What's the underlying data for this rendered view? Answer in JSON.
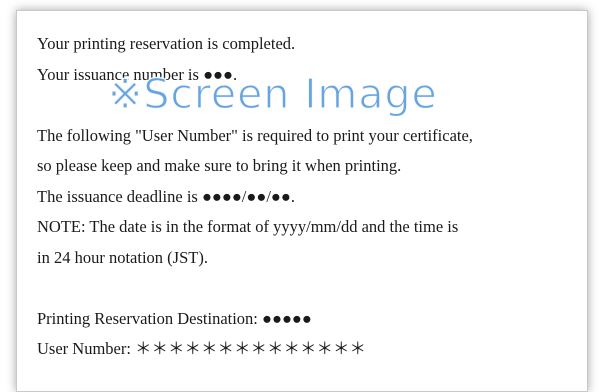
{
  "card": {
    "line1": "Your printing reservation is completed.",
    "line2": "Your issuance number is ●●●.",
    "line3": "The following \"User Number\" is required to print your certificate,",
    "line4": "so please keep and make sure to bring it when printing.",
    "line5": "The issuance deadline is ●●●●/●●/●●.",
    "line6": "NOTE: The date is in the format of yyyy/mm/dd and the time is",
    "line7": "in 24 hour notation (JST).",
    "line8": "Printing Reservation Destination: ●●●●●",
    "line9": "User Number: ＊＊＊＊＊＊＊＊＊＊＊＊＊＊"
  },
  "watermark": {
    "text": "※Screen Image",
    "color": "#4691dc"
  }
}
